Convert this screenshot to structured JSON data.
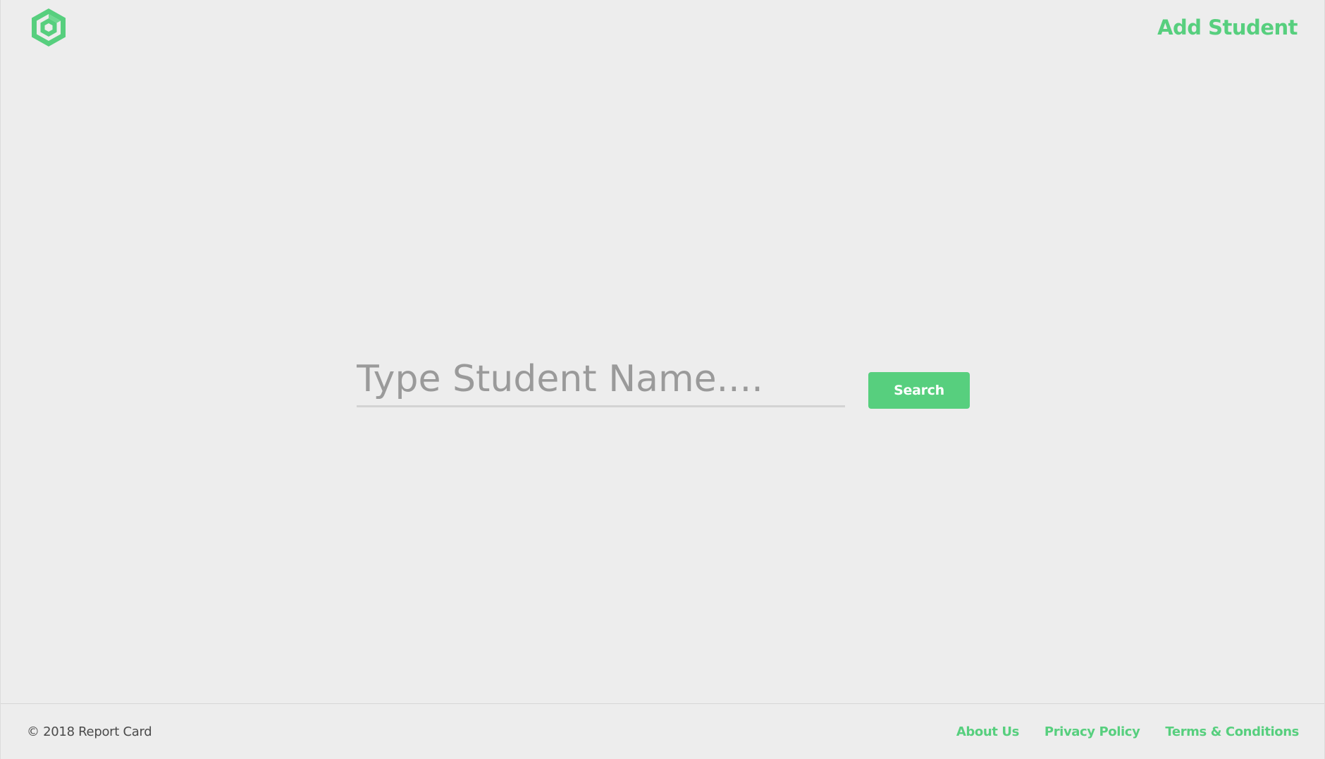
{
  "header": {
    "logo_icon": "hexagon-logo-icon",
    "add_student_label": "Add Student"
  },
  "search": {
    "placeholder": "Type Student Name....",
    "value": "",
    "button_label": "Search"
  },
  "footer": {
    "copyright": "© 2018 Report Card",
    "links": [
      {
        "label": "About Us"
      },
      {
        "label": "Privacy Policy"
      },
      {
        "label": "Terms & Conditions"
      }
    ]
  },
  "colors": {
    "accent": "#57cf7e",
    "background": "#ededed",
    "placeholder": "#9a9a9a",
    "text": "#4a4a4a"
  }
}
